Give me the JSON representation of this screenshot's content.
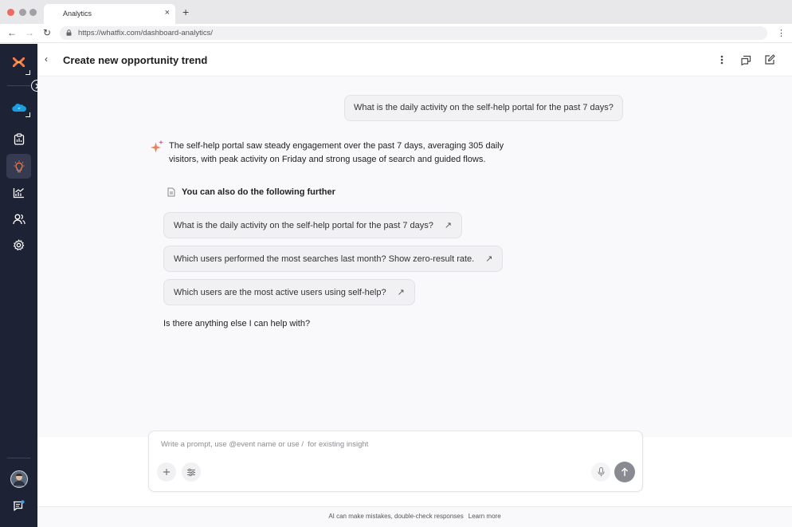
{
  "browser": {
    "tab_title": "Analytics",
    "tab_close": "×",
    "new_tab": "+",
    "url": "https://whatfix.com/dashboard-analytics/",
    "controls": {
      "red": "#ee6a5f",
      "yellow": "#a0a0a5",
      "green": "#a0a0a5"
    }
  },
  "sidebar": {
    "items": [
      {
        "icon": "whatfix-logo-icon"
      },
      {
        "icon": "salesforce-cloud-icon"
      },
      {
        "icon": "clipboard-icon"
      },
      {
        "icon": "lightbulb-icon",
        "active": true
      },
      {
        "icon": "analytics-chart-icon"
      },
      {
        "icon": "users-icon"
      },
      {
        "icon": "settings-gear-icon"
      }
    ],
    "bottom": [
      {
        "icon": "avatar"
      },
      {
        "icon": "chat-notification-icon"
      }
    ],
    "accent": "#f47c4a"
  },
  "header": {
    "title": "Create new opportunity trend",
    "actions": [
      "more-vertical-icon",
      "share-chat-icon",
      "edit-icon"
    ]
  },
  "conversation": {
    "user_question": "What is the daily activity on the self-help portal for the past 7 days?",
    "answer_line1": "The self-help portal saw steady engagement over the past 7 days, averaging 305 daily",
    "answer_line2": "visitors, with peak activity on Friday and strong usage of search and guided flows.",
    "suggestions_heading": "You can also do the following  further",
    "suggestions": [
      "What is the daily activity on the self-help portal for the past 7 days?",
      "Which users performed the most searches last month? Show zero-result rate.",
      "Which users are the most active users using self-help?"
    ],
    "followup": "Is there anything else I can help with?"
  },
  "composer": {
    "placeholder": "Write a prompt, use @event name or use /  for existing insight"
  },
  "footer": {
    "disclaimer": "AI can make mistakes, double-check responses",
    "link": "Learn more"
  }
}
